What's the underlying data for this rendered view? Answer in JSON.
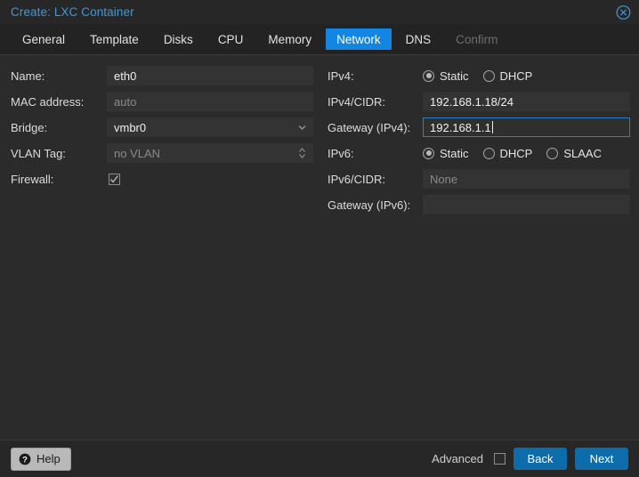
{
  "window": {
    "title": "Create: LXC Container",
    "close_icon": "close-circle-icon"
  },
  "tabs": [
    {
      "label": "General",
      "state": "normal"
    },
    {
      "label": "Template",
      "state": "normal"
    },
    {
      "label": "Disks",
      "state": "normal"
    },
    {
      "label": "CPU",
      "state": "normal"
    },
    {
      "label": "Memory",
      "state": "normal"
    },
    {
      "label": "Network",
      "state": "active"
    },
    {
      "label": "DNS",
      "state": "normal"
    },
    {
      "label": "Confirm",
      "state": "disabled"
    }
  ],
  "left_form": {
    "name": {
      "label": "Name:",
      "value": "eth0"
    },
    "mac_address": {
      "label": "MAC address:",
      "placeholder": "auto"
    },
    "bridge": {
      "label": "Bridge:",
      "value": "vmbr0",
      "icon": "chevron-down-icon"
    },
    "vlan_tag": {
      "label": "VLAN Tag:",
      "placeholder": "no VLAN",
      "icon": "spinner-arrows-icon"
    },
    "firewall": {
      "label": "Firewall:",
      "checked": true
    }
  },
  "right_form": {
    "ipv4_mode": {
      "label": "IPv4:",
      "options": [
        "Static",
        "DHCP"
      ],
      "selected": "Static"
    },
    "ipv4_cidr": {
      "label": "IPv4/CIDR:",
      "value": "192.168.1.18/24"
    },
    "ipv4_gateway": {
      "label": "Gateway (IPv4):",
      "value": "192.168.1.1",
      "focused": true
    },
    "ipv6_mode": {
      "label": "IPv6:",
      "options": [
        "Static",
        "DHCP",
        "SLAAC"
      ],
      "selected": "Static"
    },
    "ipv6_cidr": {
      "label": "IPv6/CIDR:",
      "placeholder": "None"
    },
    "ipv6_gateway": {
      "label": "Gateway (IPv6):",
      "value": ""
    }
  },
  "footer": {
    "help_label": "Help",
    "help_icon": "question-mark-icon",
    "advanced_label": "Advanced",
    "advanced_checked": false,
    "back_label": "Back",
    "next_label": "Next"
  },
  "colors": {
    "accent_tab": "#1286e2",
    "accent_button": "#0f6cab",
    "title_text": "#3b9ae0",
    "focus_border": "#2b7fc9",
    "window_bg": "#2b2b2b",
    "field_bg": "#333333"
  }
}
